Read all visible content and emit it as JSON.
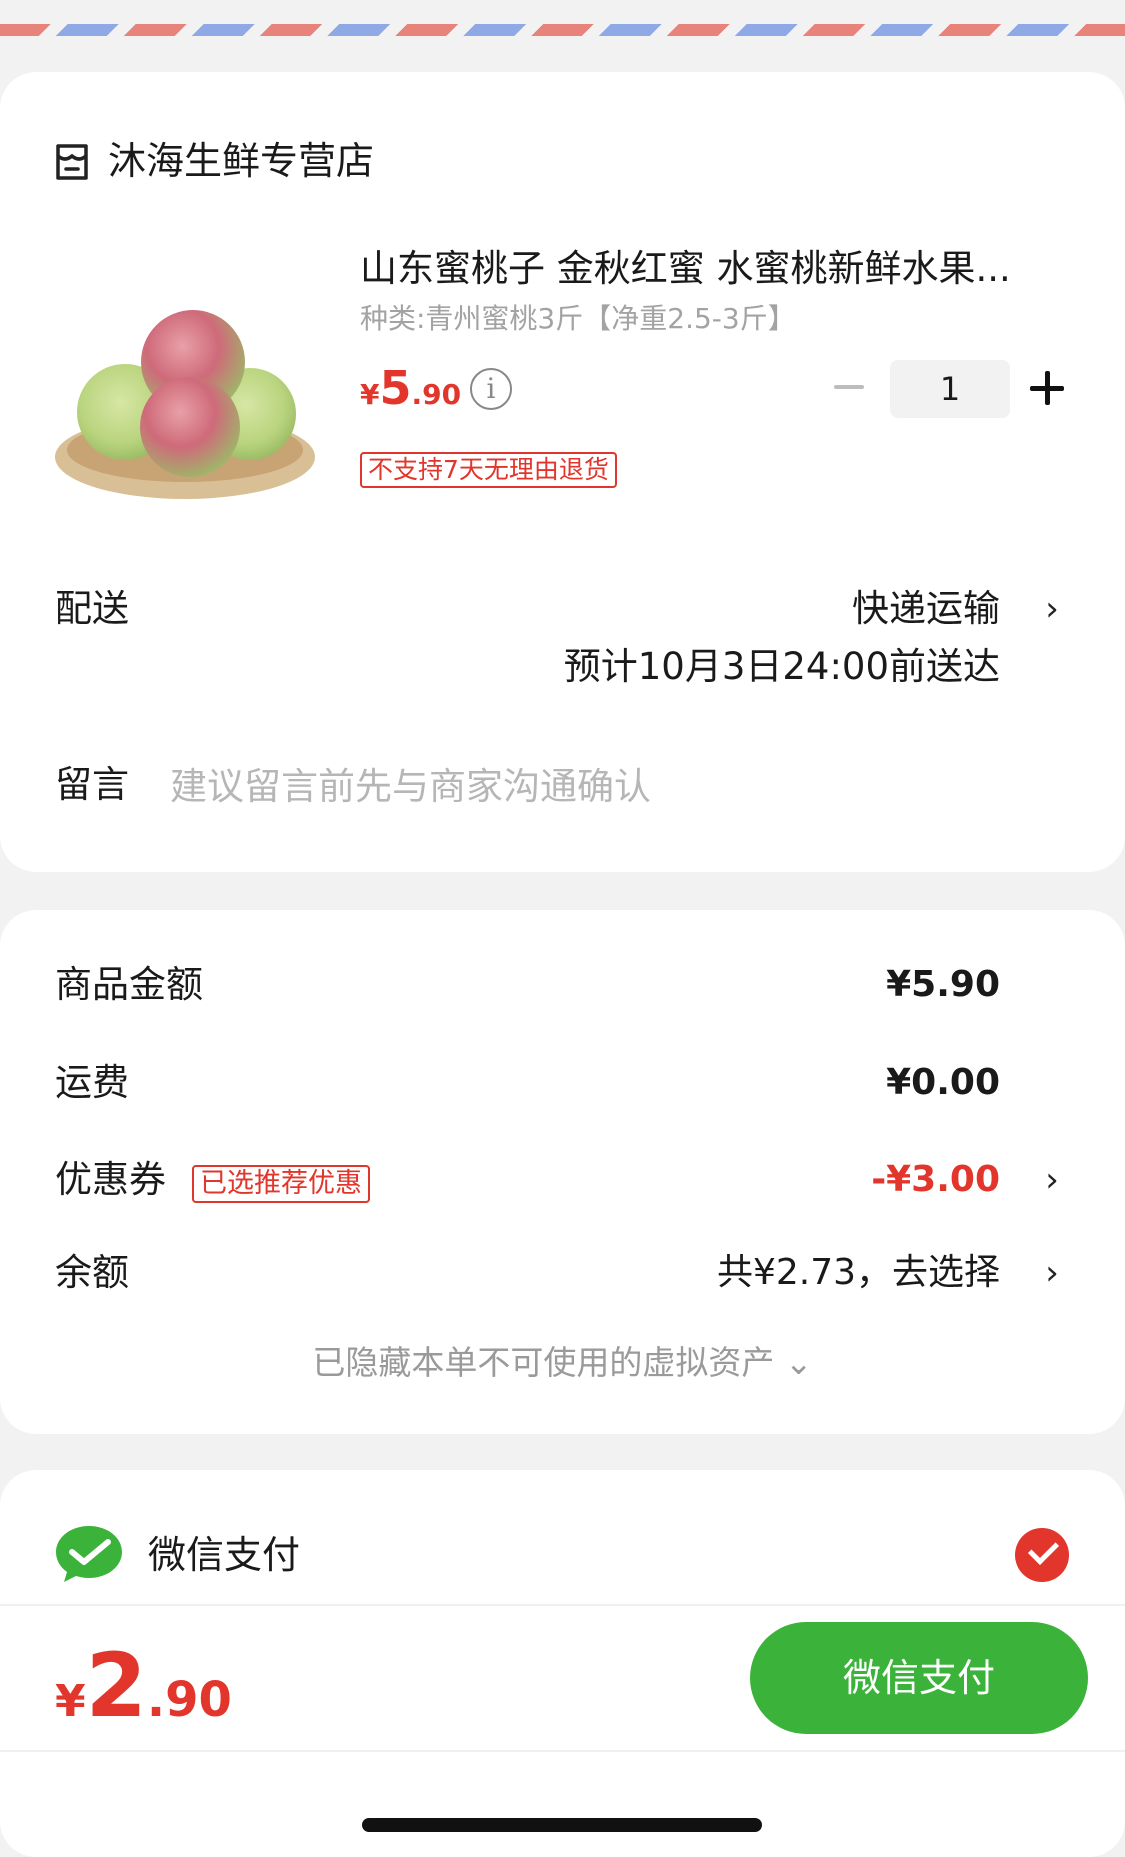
{
  "shop": {
    "name": "沐海生鲜专营店",
    "icon": "shop-icon"
  },
  "product": {
    "title": "山东蜜桃子 金秋红蜜 水蜜桃新鲜水果...",
    "spec": "种类:青州蜜桃3斤【净重2.5-3斤】",
    "price": {
      "symbol": "¥",
      "integer": "5",
      "decimal": ".90"
    },
    "info_icon": "i",
    "quantity": "1",
    "return_policy_tag": "不支持7天无理由退货",
    "image": "peach-basket-image"
  },
  "delivery": {
    "label": "配送",
    "method": "快递运输",
    "eta": "预计10月3日24:00前送达"
  },
  "message": {
    "label": "留言",
    "placeholder": "建议留言前先与商家沟通确认"
  },
  "summary": {
    "goods_label": "商品金额",
    "goods_value": "¥5.90",
    "shipping_label": "运费",
    "shipping_value": "¥0.00",
    "coupon_label": "优惠券",
    "coupon_tag": "已选推荐优惠",
    "coupon_value": "-¥3.00",
    "balance_label": "余额",
    "balance_value": "共¥2.73，去选择",
    "hidden_assets": "已隐藏本单不可使用的虚拟资产 ⌄"
  },
  "payment": {
    "method_label": "微信支付",
    "selected": true
  },
  "checkout": {
    "total": {
      "symbol": "¥",
      "integer": "2",
      "decimal": ".90"
    },
    "pay_button": "微信支付"
  },
  "colors": {
    "accent_red": "#e2352b",
    "wechat_green": "#3bb33a"
  }
}
